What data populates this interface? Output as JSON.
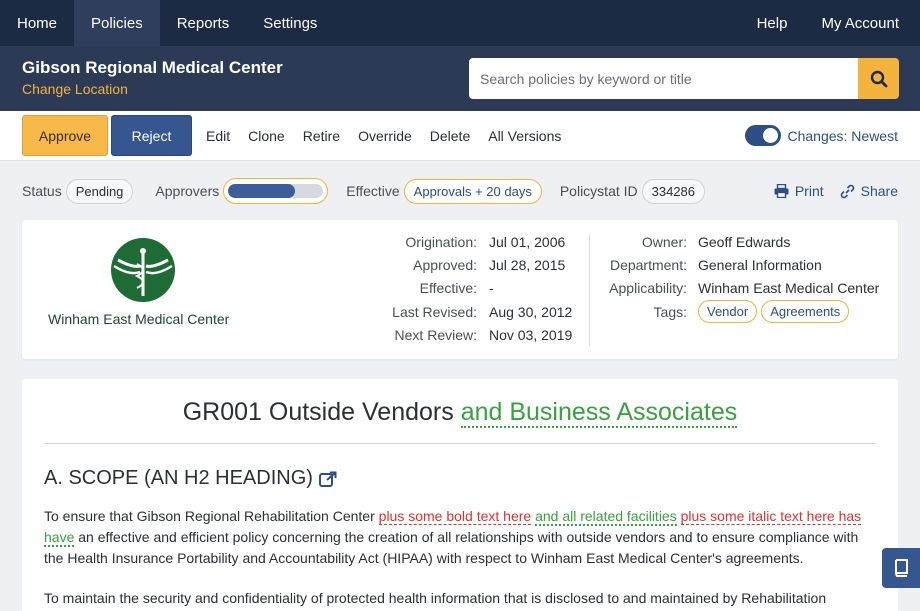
{
  "nav": {
    "left": [
      {
        "label": "Home",
        "active": false
      },
      {
        "label": "Policies",
        "active": true
      },
      {
        "label": "Reports",
        "active": false
      },
      {
        "label": "Settings",
        "active": false
      }
    ],
    "right": [
      {
        "label": "Help"
      },
      {
        "label": "My Account"
      }
    ]
  },
  "header": {
    "org_name": "Gibson Regional Medical Center",
    "change_location": "Change Location",
    "search_placeholder": "Search policies by keyword or title",
    "search_icon": "search-icon"
  },
  "toolbar": {
    "approve": "Approve",
    "reject": "Reject",
    "links": [
      "Edit",
      "Clone",
      "Retire",
      "Override",
      "Delete",
      "All Versions"
    ],
    "changes_label": "Changes: Newest",
    "changes_on": true
  },
  "status": {
    "status_label": "Status",
    "status_value": "Pending",
    "approvers_label": "Approvers",
    "approvers_progress": 0.7,
    "effective_label": "Effective",
    "effective_value": "Approvals + 20 days",
    "policystat_label": "Policystat ID",
    "policystat_value": "334286",
    "print_label": "Print",
    "share_label": "Share"
  },
  "meta": {
    "logo_text": "Winham East Medical Center",
    "dates": [
      {
        "label": "Origination:",
        "value": "Jul 01, 2006"
      },
      {
        "label": "Approved:",
        "value": "Jul 28, 2015"
      },
      {
        "label": "Effective:",
        "value": "-"
      },
      {
        "label": "Last Revised:",
        "value": "Aug 30, 2012"
      },
      {
        "label": "Next Review:",
        "value": "Nov 03, 2019"
      }
    ],
    "owner_label": "Owner:",
    "owner_value": "Geoff Edwards",
    "department_label": "Department:",
    "department_value": "General Information",
    "applicability_label": "Applicability:",
    "applicability_value": "Winham East Medical Center",
    "tags_label": "Tags:",
    "tags": [
      "Vendor",
      "Agreements"
    ]
  },
  "document": {
    "title_base": "GR001 Outside Vendors",
    "title_inserted": "and Business Associates",
    "heading": "A. SCOPE (AN H2 HEADING)",
    "p1_start": "To ensure that Gibson Regional Rehabilitation Center",
    "p1_del1": "plus some bold text here",
    "p1_ins1": "and all related facilities",
    "p1_del2": "plus some italic text here has",
    "p1_ins2": "have",
    "p1_rest": "an effective and efficient policy concerning the creation of all relationships with outside vendors and to ensure compliance with the Health Insurance Portability and Accountability Act (HIPAA) with respect to Winham East Medical Center's agreements.",
    "p2": "To maintain the security and confidentiality of protected health information that is disclosed to and maintained by Rehabilitation"
  },
  "colors": {
    "nav_bg": "#1c2a44",
    "header_bg": "#2c3a55",
    "accent": "#f3b33d",
    "primary": "#35568f",
    "inserted": "#3aa041",
    "deleted": "#d8332e"
  }
}
